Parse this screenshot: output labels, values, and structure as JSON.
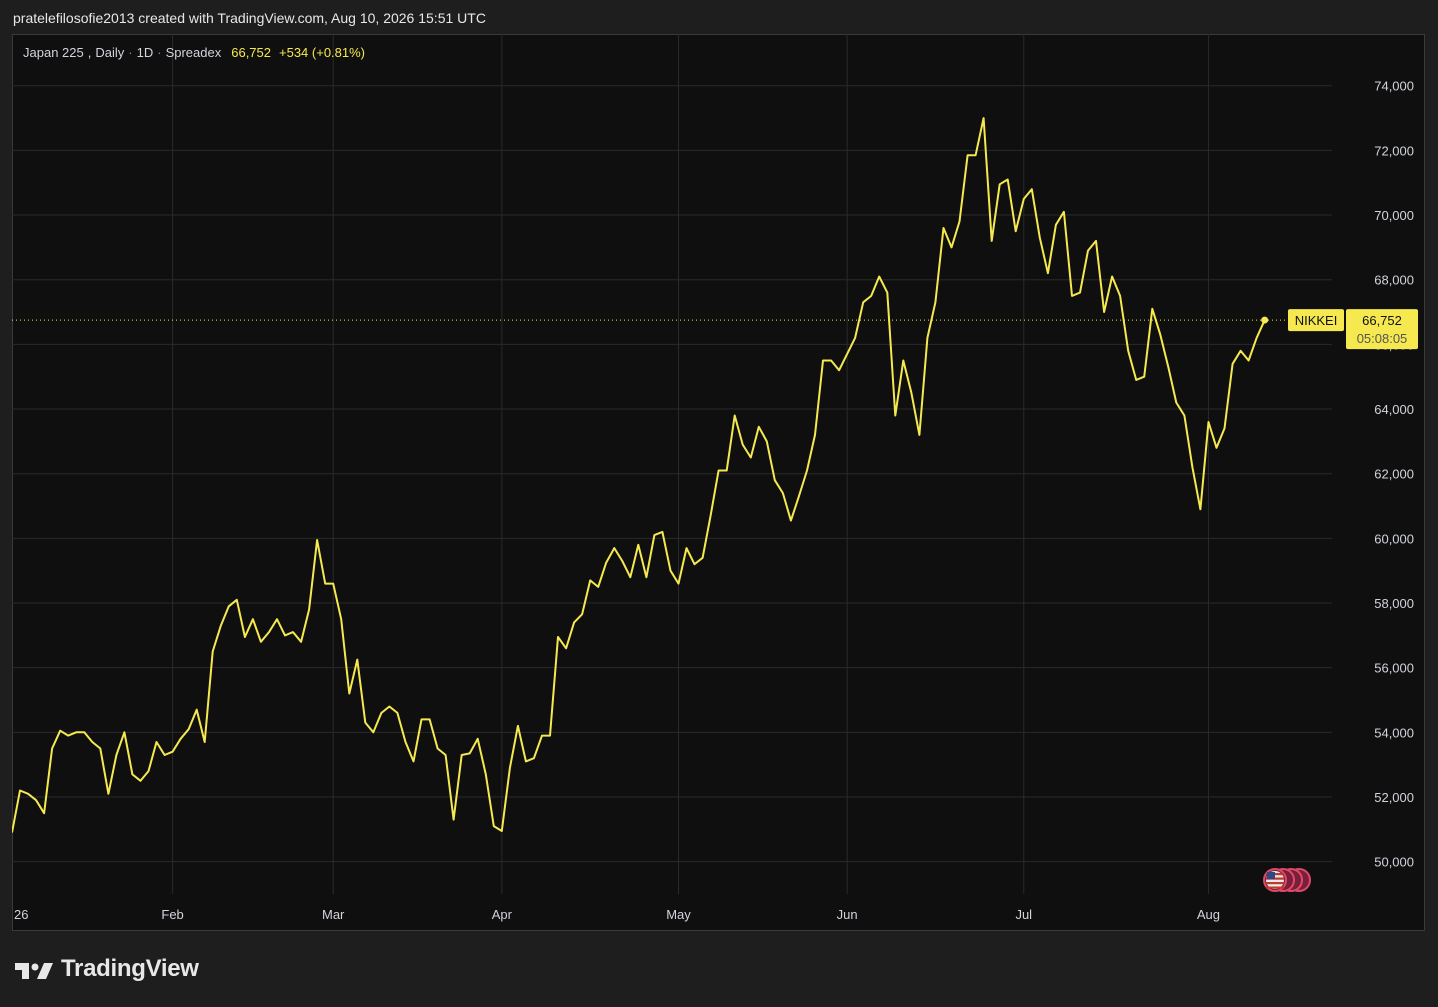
{
  "attribution": "pratelefilosofie2013 created with TradingView.com, Aug 10, 2026 15:51 UTC",
  "legend": {
    "symbol": "Japan 225",
    "interval": "Daily",
    "interval_code": "1D",
    "source": "Spreadex",
    "price": "66,752",
    "change": "+534 (+0.81%)",
    "dot1": "·",
    "dot2": "·"
  },
  "brand": {
    "name": "TradingView"
  },
  "colors": {
    "line": "#f5e94f",
    "background": "#0f0f0f",
    "grid": "#2a2a2a",
    "text": "#d1d4dc"
  },
  "price_label": {
    "symbol": "NIKKEI",
    "price": "66,752",
    "countdown": "05:08:05"
  },
  "events_marker": {
    "icon": "us-flag-icon",
    "count": 4
  },
  "chart_data": {
    "type": "line",
    "title": "Japan 225, Daily · 1D · Spreadex",
    "ylim": [
      49000,
      75600
    ],
    "y_ticks": [
      50000,
      52000,
      54000,
      56000,
      58000,
      60000,
      62000,
      64000,
      66000,
      68000,
      70000,
      72000,
      74000
    ],
    "y_tick_labels": [
      "50,000",
      "52,000",
      "54,000",
      "56,000",
      "58,000",
      "60,000",
      "62,000",
      "64,000",
      "66,000",
      "68,000",
      "70,000",
      "72,000",
      "74,000"
    ],
    "x_ticks": [
      {
        "label": "26",
        "index": 0
      },
      {
        "label": "Feb",
        "index": 20
      },
      {
        "label": "Mar",
        "index": 40
      },
      {
        "label": "Apr",
        "index": 61
      },
      {
        "label": "May",
        "index": 83
      },
      {
        "label": "Jun",
        "index": 104
      },
      {
        "label": "Jul",
        "index": 126
      },
      {
        "label": "Aug",
        "index": 149
      }
    ],
    "last_value": 66752,
    "series": [
      {
        "name": "NIKKEI",
        "values": [
          50900,
          52200,
          52100,
          51900,
          51500,
          53500,
          54050,
          53900,
          54000,
          54000,
          53700,
          53500,
          52100,
          53300,
          54000,
          52700,
          52500,
          52800,
          53700,
          53300,
          53400,
          53800,
          54100,
          54700,
          53700,
          56500,
          57300,
          57900,
          58100,
          56950,
          57500,
          56800,
          57100,
          57500,
          57000,
          57100,
          56800,
          57800,
          59950,
          58600,
          58600,
          57500,
          55200,
          56250,
          54300,
          54000,
          54600,
          54800,
          54600,
          53700,
          53100,
          54400,
          54400,
          53500,
          53300,
          51300,
          53300,
          53350,
          53800,
          52700,
          51100,
          50950,
          52900,
          54200,
          53100,
          53200,
          53900,
          53900,
          56950,
          56600,
          57400,
          57650,
          58700,
          58500,
          59250,
          59700,
          59300,
          58800,
          59800,
          58800,
          60100,
          60200,
          59000,
          58600,
          59700,
          59200,
          59400,
          60700,
          62100,
          62100,
          63800,
          62900,
          62500,
          63450,
          63000,
          61800,
          61400,
          60550,
          61300,
          62100,
          63200,
          65500,
          65500,
          65200,
          65700,
          66200,
          67300,
          67500,
          68100,
          67600,
          63800,
          65500,
          64500,
          63200,
          66200,
          67300,
          69600,
          69000,
          69800,
          71850,
          71850,
          73000,
          69200,
          70950,
          71100,
          69500,
          70500,
          70800,
          69300,
          68200,
          69700,
          70100,
          67500,
          67600,
          68900,
          69200,
          67000,
          68100,
          67500,
          65800,
          64900,
          65000,
          67100,
          66300,
          65300,
          64200,
          63800,
          62200,
          60900,
          63600,
          62800,
          63400,
          65400,
          65800,
          65500,
          66200,
          66752
        ]
      }
    ]
  }
}
